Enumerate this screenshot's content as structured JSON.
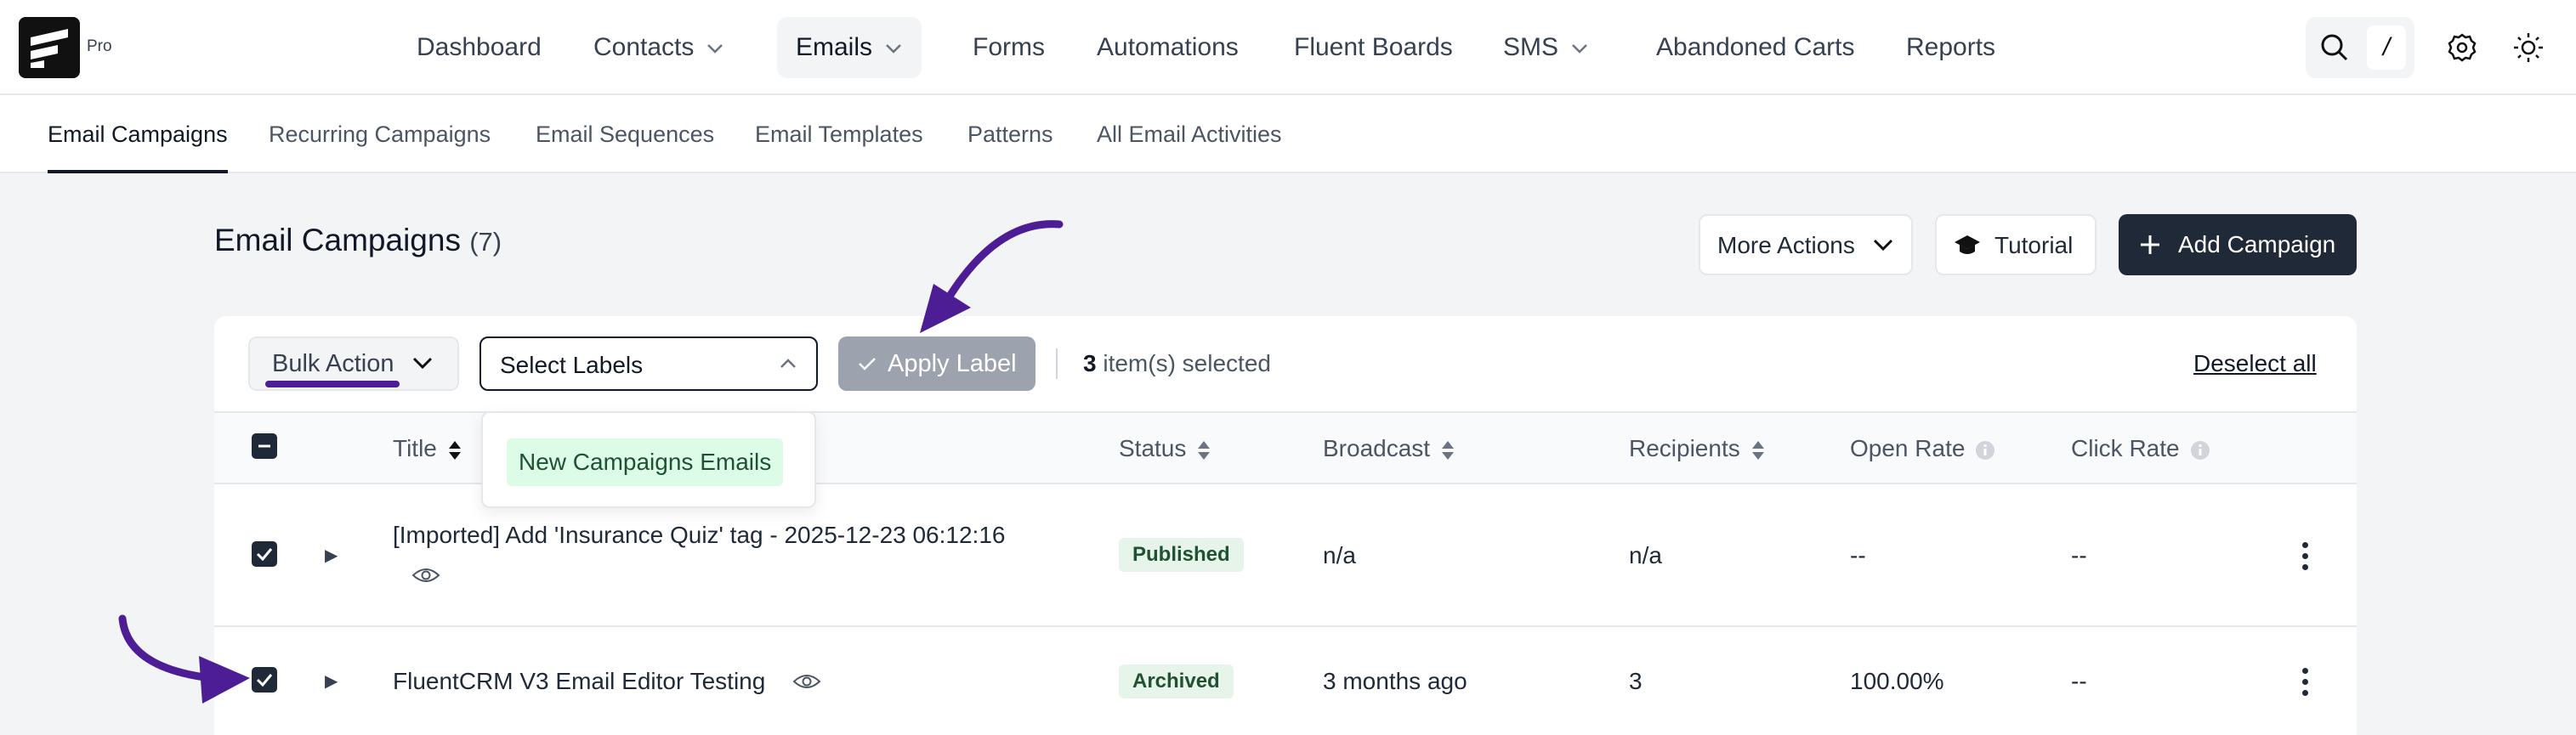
{
  "brand": {
    "badge": "Pro"
  },
  "nav": {
    "items": [
      {
        "label": "Dashboard"
      },
      {
        "label": "Contacts"
      },
      {
        "label": "Emails"
      },
      {
        "label": "Forms"
      },
      {
        "label": "Automations"
      },
      {
        "label": "Fluent Boards"
      },
      {
        "label": "SMS"
      },
      {
        "label": "Abandoned Carts"
      },
      {
        "label": "Reports"
      }
    ],
    "active": "Emails",
    "search_shortcut": "/"
  },
  "subnav": {
    "items": [
      {
        "label": "Email Campaigns"
      },
      {
        "label": "Recurring Campaigns"
      },
      {
        "label": "Email Sequences"
      },
      {
        "label": "Email Templates"
      },
      {
        "label": "Patterns"
      },
      {
        "label": "All Email Activities"
      }
    ],
    "active": "Email Campaigns"
  },
  "page": {
    "title": "Email Campaigns",
    "count": "(7)",
    "more_actions": "More Actions",
    "tutorial": "Tutorial",
    "add_campaign": "Add Campaign"
  },
  "toolbar": {
    "bulk_action": "Bulk Action",
    "labels_placeholder": "Select Labels",
    "apply_label": "Apply Label",
    "selected_count": "3",
    "selected_suffix": "item(s) selected",
    "deselect_all": "Deselect all"
  },
  "labels_dropdown": {
    "options": [
      "New Campaigns Emails"
    ]
  },
  "table": {
    "columns": {
      "title": "Title",
      "status": "Status",
      "broadcast": "Broadcast",
      "recipients": "Recipients",
      "open_rate": "Open Rate",
      "click_rate": "Click Rate"
    },
    "rows": [
      {
        "title": "[Imported] Add 'Insurance Quiz' tag - 2025-12-23 06:12:16",
        "status": "Published",
        "broadcast": "n/a",
        "recipients": "n/a",
        "open_rate": "--",
        "click_rate": "--"
      },
      {
        "title": "FluentCRM V3 Email Editor Testing",
        "status": "Archived",
        "broadcast": "3 months ago",
        "recipients": "3",
        "open_rate": "100.00%",
        "click_rate": "--"
      }
    ]
  },
  "colors": {
    "annotation_arrow": "#4c1d95",
    "primary_button": "#1f2937",
    "badge_bg": "#e6f4ea",
    "label_chip_bg": "#dcfce7"
  }
}
